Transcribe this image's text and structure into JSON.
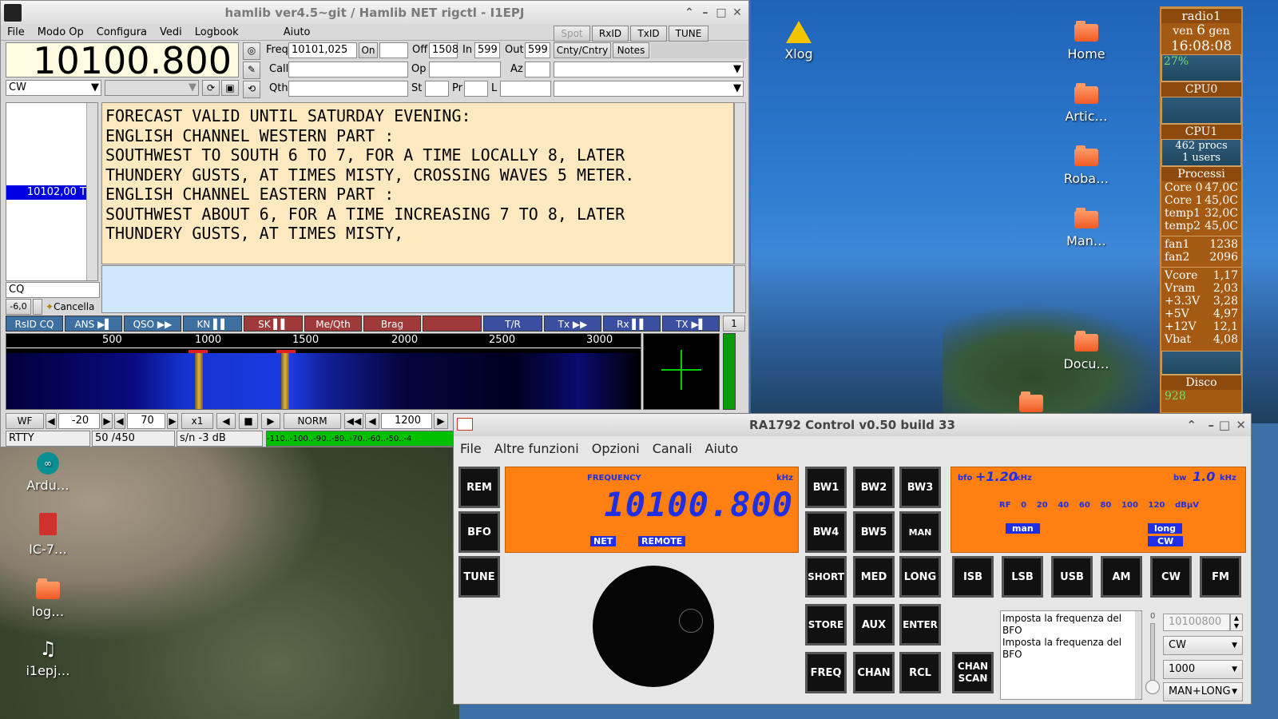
{
  "fldigi": {
    "title": "hamlib ver4.5~git / Hamlib NET rigctl - I1EPJ",
    "menu": [
      "File",
      "Modo Op",
      "Configura",
      "Vedi",
      "Logbook",
      "Aiuto"
    ],
    "toggles": [
      "Spot",
      "RxID",
      "TxID",
      "TUNE"
    ],
    "frequency": "10100.800",
    "mode": "CW",
    "fields": {
      "freq_label": "Freq",
      "freq": "10101,025",
      "on_label": "On",
      "off_label": "Off",
      "off": "1508",
      "in_label": "In",
      "in": "599",
      "out_label": "Out",
      "out": "599",
      "cnty_label": "Cnty/Cntry",
      "notes_label": "Notes",
      "call_label": "Call",
      "op_label": "Op",
      "az_label": "Az",
      "qth_label": "Qth",
      "st_label": "St",
      "pr_label": "Pr",
      "l_label": "L"
    },
    "list_selected": "10102,00 T",
    "cq_field": "CQ",
    "squelch": "-6,0",
    "clear_label": "Cancella",
    "rx_text": [
      "FORECAST VALID UNTIL SATURDAY EVENING:",
      "ENGLISH CHANNEL WESTERN PART :",
      "SOUTHWEST TO SOUTH 6 TO 7, FOR A TIME LOCALLY 8, LATER",
      "THUNDERY GUSTS, AT TIMES MISTY, CROSSING WAVES 5 METER.",
      "ENGLISH CHANNEL EASTERN PART :",
      "SOUTHWEST ABOUT 6, FOR A TIME INCREASING 7 TO 8, LATER",
      "THUNDERY GUSTS, AT TIMES MISTY,"
    ],
    "macros": [
      {
        "label": "RsID CQ",
        "color": "#3d6fa0"
      },
      {
        "label": "ANS ▶▌",
        "color": "#3d6fa0"
      },
      {
        "label": "QSO ▶▶",
        "color": "#3d6fa0"
      },
      {
        "label": "KN ▌▌",
        "color": "#3d6fa0"
      },
      {
        "label": "SK ▌▌",
        "color": "#a03a3a"
      },
      {
        "label": "Me/Qth",
        "color": "#a03a3a"
      },
      {
        "label": "Brag",
        "color": "#a03a3a"
      },
      {
        "label": "",
        "color": "#a03a3a"
      },
      {
        "label": "T/R",
        "color": "#3b4fa0"
      },
      {
        "label": "Tx ▶▶",
        "color": "#3b4fa0"
      },
      {
        "label": "Rx ▌▌",
        "color": "#3b4fa0"
      },
      {
        "label": "TX ▶▌",
        "color": "#3b4fa0"
      }
    ],
    "macro_page": "1",
    "scale": [
      "500",
      "1000",
      "1500",
      "2000",
      "2500",
      "3000"
    ],
    "wf_controls": {
      "wf": "WF",
      "ref": "-20",
      "range": "70",
      "zoom": "x1",
      "norm": "NORM",
      "carrier": "1200"
    },
    "status": {
      "mode": "RTTY",
      "shift": "50 /450",
      "sn": "s/n -3  dB",
      "meter": "-110..-100..-90..-80..-70..-60..-50..-4"
    }
  },
  "desktop_icons": [
    {
      "label": "Xlog",
      "icon": "warning-icon"
    },
    {
      "label": "Home",
      "icon": "home-folder-icon"
    },
    {
      "label": "Artic…",
      "icon": "folder-icon"
    },
    {
      "label": "Roba…",
      "icon": "folder-icon"
    },
    {
      "label": "Man…",
      "icon": "folder-icon"
    },
    {
      "label": "Docu…",
      "icon": "folder-icon"
    },
    {
      "label": "Ardu…",
      "icon": "arduino-icon"
    },
    {
      "label": "IC-7…",
      "icon": "document-icon"
    },
    {
      "label": "log…",
      "icon": "folder-icon"
    },
    {
      "label": "i1epj…",
      "icon": "music-icon"
    }
  ],
  "conky": {
    "host": "radio1",
    "day": "ven",
    "date_num": "6",
    "month": "gen",
    "time": "16:08:08",
    "pct": "27%",
    "cpu0": "CPU0",
    "cpu1": "CPU1",
    "procs": "462 procs",
    "users": "1 users",
    "processi": "Processi",
    "sensors": [
      [
        "Core 0",
        "47,0C"
      ],
      [
        "Core 1",
        "45,0C"
      ],
      [
        "temp1",
        "32,0C"
      ],
      [
        "temp2",
        "45,0C"
      ]
    ],
    "fans": [
      [
        "fan1",
        "1238"
      ],
      [
        "fan2",
        "2096"
      ]
    ],
    "volts": [
      [
        "Vcore",
        "1,17"
      ],
      [
        "Vram",
        "2,03"
      ],
      [
        "+3.3V",
        "3,28"
      ],
      [
        "+5V",
        "4,97"
      ],
      [
        "+12V",
        "12,1"
      ],
      [
        "Vbat",
        "4,08"
      ]
    ],
    "disco": "Disco",
    "disco_val": "928"
  },
  "ra": {
    "title": "RA1792 Control v0.50 build 33",
    "menu": [
      "File",
      "Altre funzioni",
      "Opzioni",
      "Canali",
      "Aiuto"
    ],
    "left_buttons": [
      "REM",
      "BFO",
      "TUNE"
    ],
    "freq_label": "FREQUENCY",
    "freq_unit": "kHz",
    "frequency": "10100.800",
    "net": "NET",
    "remote": "REMOTE",
    "grid_buttons": [
      "BW1",
      "BW2",
      "BW3",
      "BW4",
      "BW5",
      "MAN",
      "SHORT",
      "MED",
      "LONG",
      "STORE",
      "AUX",
      "ENTER",
      "FREQ",
      "CHAN",
      "RCL"
    ],
    "bfo_label": "bfo",
    "bfo": "+1.20",
    "bfo_unit": "kHz",
    "bw_label": "bw",
    "bw": "1.0",
    "bw_unit": "kHz",
    "rf_scale": [
      "RF",
      "0",
      "20",
      "40",
      "60",
      "80",
      "100",
      "120",
      "dBµV"
    ],
    "man_tag": "man",
    "long_tag": "long",
    "cw_tag": "CW",
    "modes": [
      "ISB",
      "LSB",
      "USB",
      "AM",
      "CW",
      "FM"
    ],
    "chan_scan": "CHAN SCAN",
    "log": [
      "Imposta la frequenza del BFO",
      "Imposta la frequenza del BFO"
    ],
    "spin_zero": "0",
    "freq_input": "10100800",
    "mode_select": "CW",
    "bw_select": "1000",
    "agc_select": "MAN+LONG"
  }
}
